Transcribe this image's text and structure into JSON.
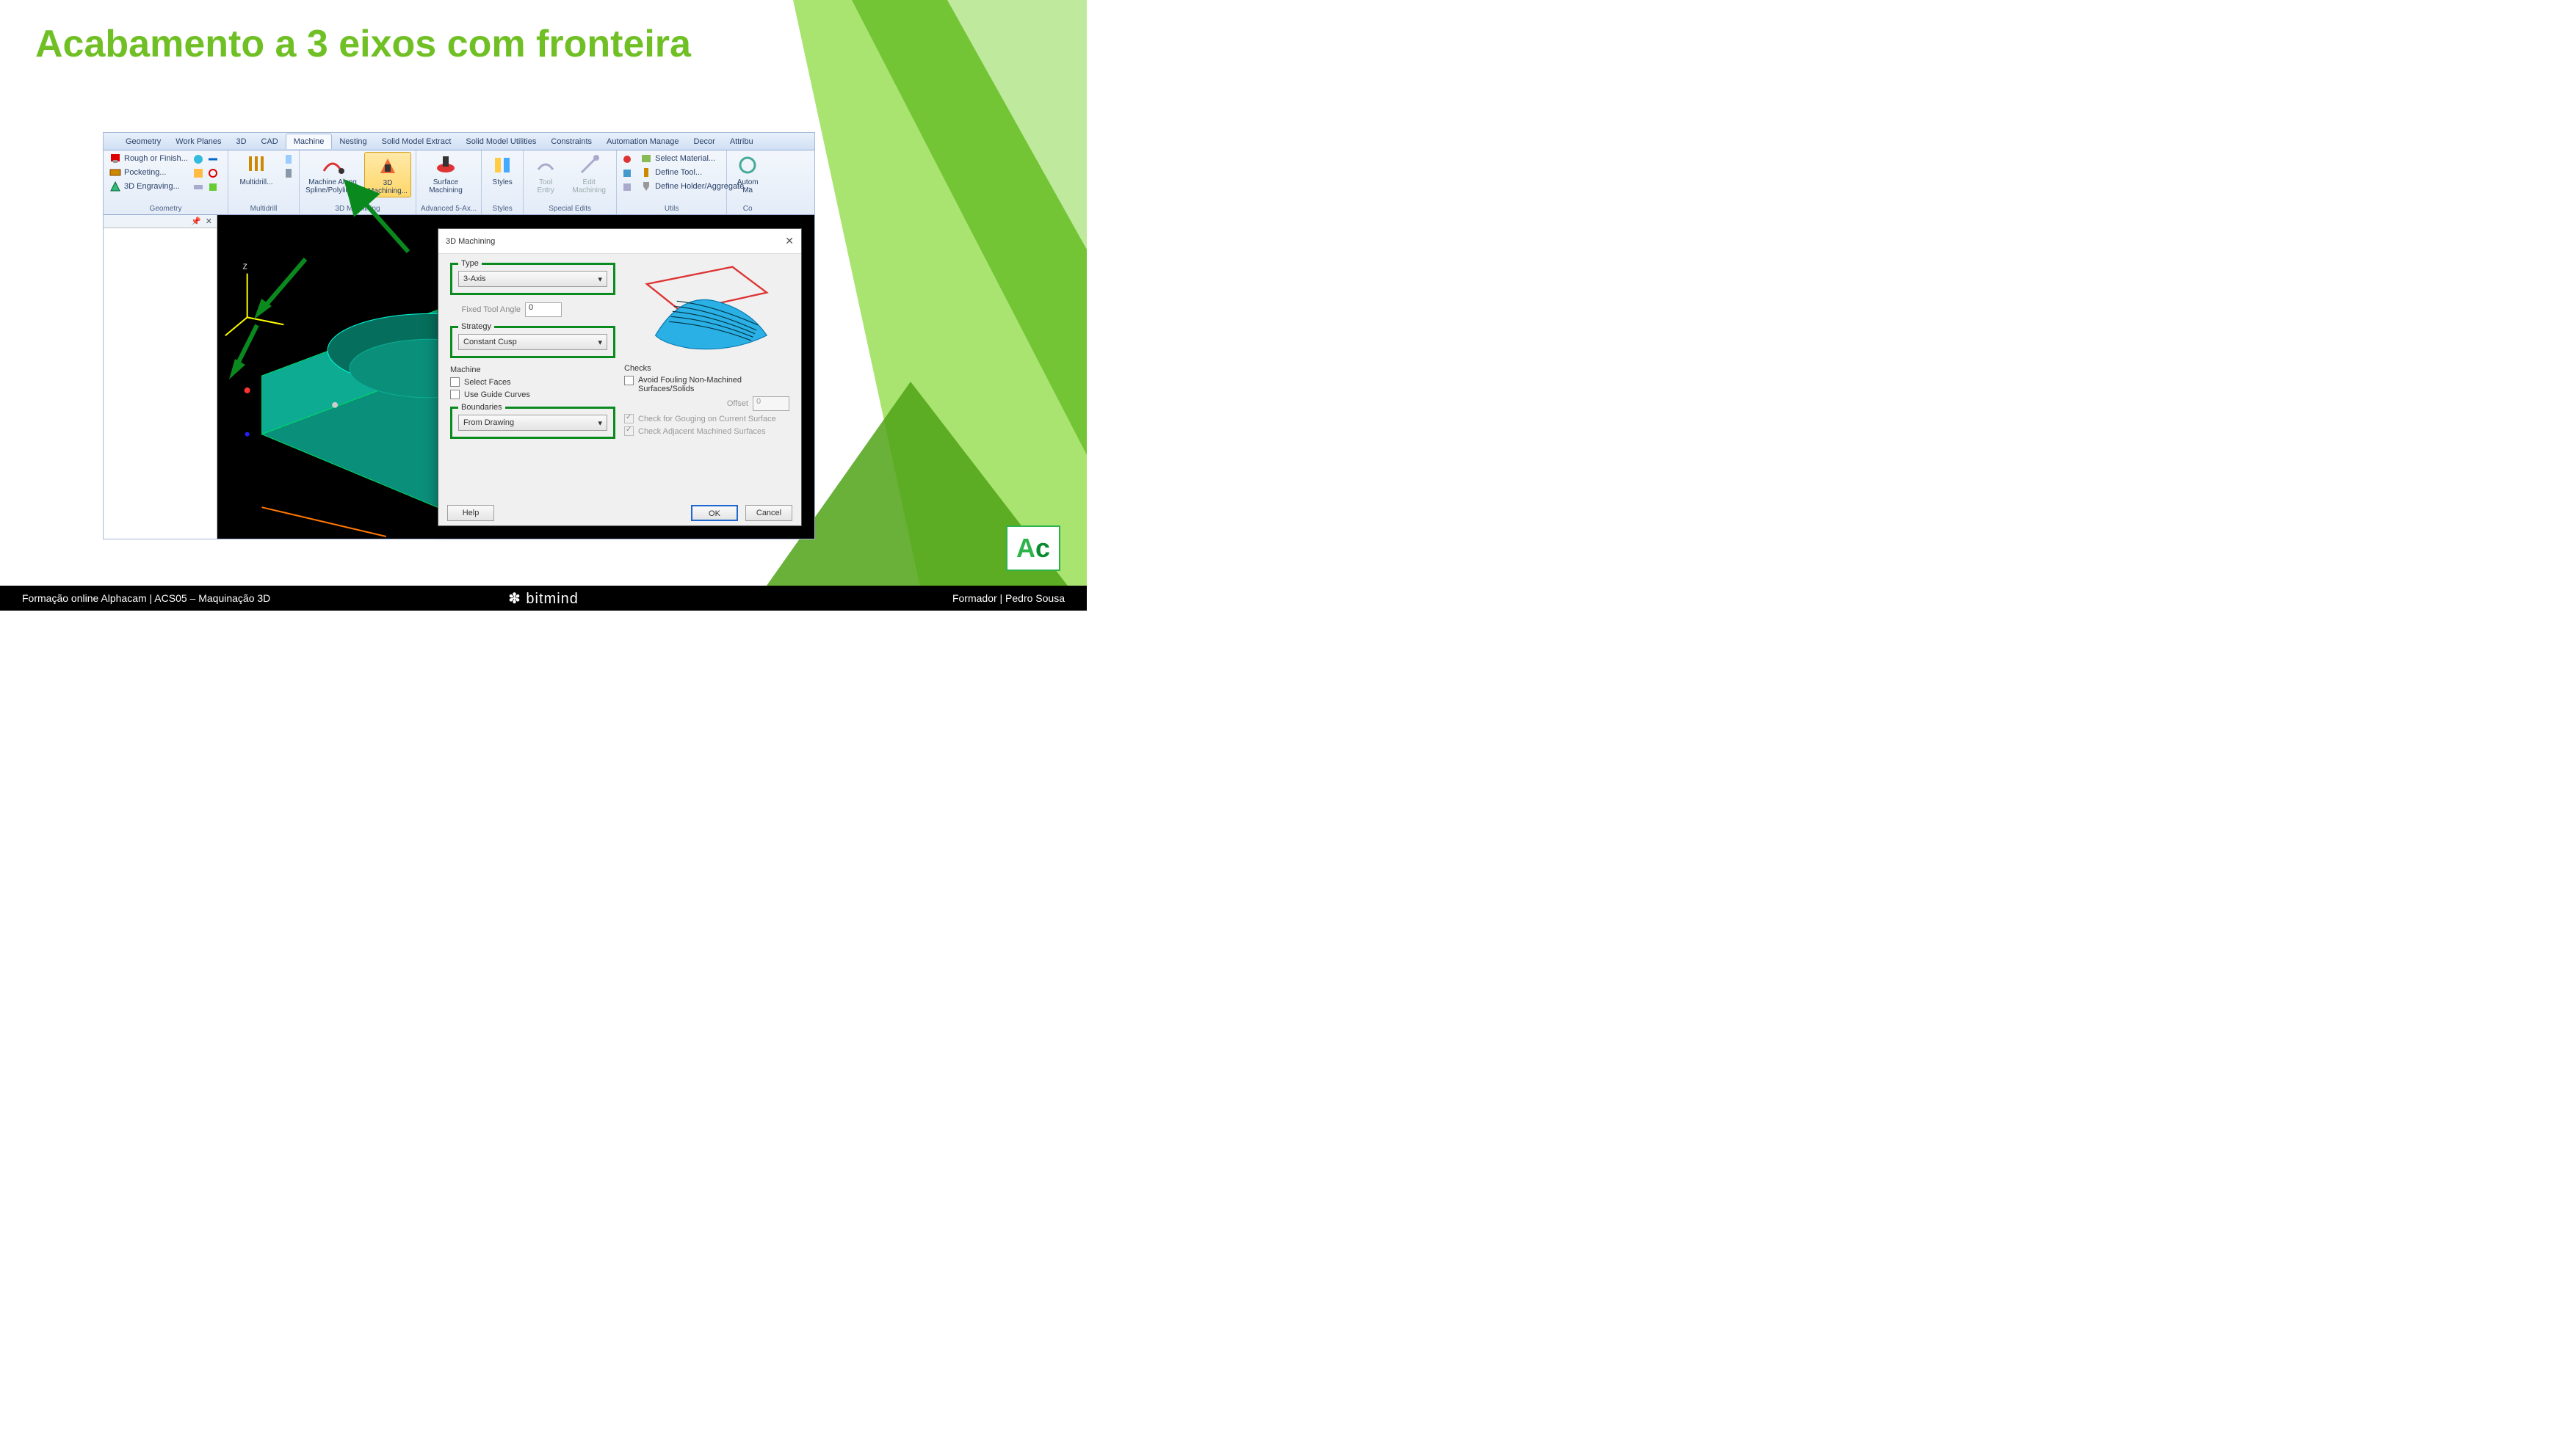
{
  "slide": {
    "title": "Acabamento a 3 eixos com fronteira",
    "footer_left": "Formação online Alphacam | ACS05 – Maquinação 3D",
    "footer_center": "✽ bitmind",
    "footer_right": "Formador | Pedro Sousa",
    "badge": "Ac"
  },
  "ribbon": {
    "tabs": [
      "Geometry",
      "Work Planes",
      "3D",
      "CAD",
      "Machine",
      "Nesting",
      "Solid Model Extract",
      "Solid Model Utilities",
      "Constraints",
      "Automation Manage",
      "Decor",
      "Attribu"
    ],
    "active_tab": "Machine",
    "groups": {
      "geometry": {
        "label": "Geometry",
        "items": [
          "Rough or Finish...",
          "Pocketing...",
          "3D Engraving..."
        ]
      },
      "multidrill": {
        "label": "Multidrill",
        "btn": "Multidrill..."
      },
      "machining3d": {
        "label": "3D Machining",
        "btns": [
          "Machine Along Spline/Polyline...",
          "3D Machining..."
        ]
      },
      "adv5": {
        "label": "Advanced 5-Ax...",
        "btn": "Surface Machining"
      },
      "styles": {
        "label": "Styles",
        "btn": "Styles"
      },
      "special": {
        "label": "Special Edits",
        "btns": [
          "Tool Entry",
          "Edit Machining"
        ]
      },
      "utils": {
        "label": "Utils",
        "items": [
          "Select Material...",
          "Define Tool...",
          "Define Holder/Aggregate..."
        ]
      },
      "co": {
        "label": "Co",
        "btn": "Autom Ma"
      }
    }
  },
  "dialog": {
    "title": "3D Machining",
    "type_label": "Type",
    "type_value": "3-Axis",
    "fixed_tool_angle_label": "Fixed Tool Angle",
    "fixed_tool_angle_value": "0",
    "strategy_label": "Strategy",
    "strategy_value": "Constant Cusp",
    "machine_label": "Machine",
    "select_faces": "Select Faces",
    "use_guide_curves": "Use Guide Curves",
    "boundaries_label": "Boundaries",
    "boundaries_value": "From Drawing",
    "checks_label": "Checks",
    "avoid_fouling": "Avoid Fouling Non-Machined Surfaces/Solids",
    "offset_label": "Offset",
    "offset_value": "0",
    "gouge_current": "Check for Gouging on Current Surface",
    "gouge_adjacent": "Check Adjacent Machined Surfaces",
    "help": "Help",
    "ok": "OK",
    "cancel": "Cancel"
  }
}
